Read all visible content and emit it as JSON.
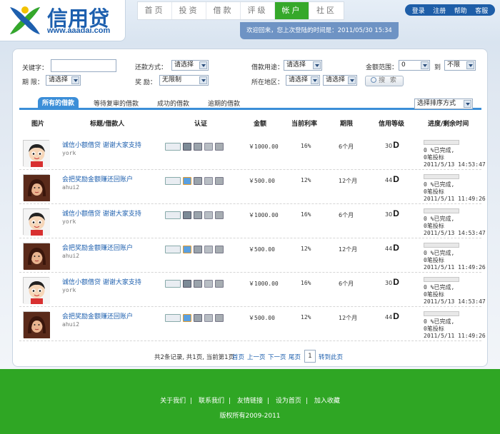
{
  "brand": {
    "name": "信用贷",
    "url": "www.aaadai.com",
    "colors": {
      "blue": "#1d5fae",
      "green": "#35a82a",
      "yellow": "#f2c200"
    }
  },
  "nav": [
    {
      "label": "首页"
    },
    {
      "label": "投资"
    },
    {
      "label": "借款"
    },
    {
      "label": "评级"
    },
    {
      "label": "帐户",
      "active": true
    },
    {
      "label": "社区"
    }
  ],
  "user_bar": {
    "login": "登录",
    "register": "注册",
    "help": "帮助",
    "service": "客服"
  },
  "welcome": "欢迎回来，您上次登陆的时间是：2011/05/30 15:34",
  "filters": {
    "keyword_label": "关键字：",
    "repay_label": "还款方式：",
    "repay_value": "请选择",
    "purpose_label": "借款用途：",
    "purpose_value": "请选择",
    "amount_label": "金额范围：",
    "amount_min": "0",
    "amount_to": "到",
    "amount_max": "不限",
    "term_label": "期 限：",
    "term_value": "请选择",
    "reward_label": "奖 励：",
    "reward_value": "无限制",
    "region_label": "所在地区：",
    "province_value": "请选择",
    "city_value": "请选择",
    "search_label": "搜 索"
  },
  "tabs": [
    {
      "label": "所有的借款",
      "active": true
    },
    {
      "label": "等待复审的借款"
    },
    {
      "label": "成功的借款"
    },
    {
      "label": "逾期的借款"
    }
  ],
  "sort_select": "选择排序方式",
  "columns": {
    "image": "图片",
    "title": "标题/借款人",
    "auth": "认证",
    "amount": "金额",
    "rate": "当前利率",
    "term": "期限",
    "grade": "信用等级",
    "progress": "进度/剩余时间"
  },
  "rows": [
    {
      "title": "诚信小额借贷 谢谢大家支持",
      "user": "york",
      "avatar": "boy",
      "amount": "￥1000.00",
      "rate": "16%",
      "term": "6个月",
      "score": "30",
      "grade": "D",
      "progress_line1": "0 %已完成,",
      "progress_line2": "0笔投标",
      "date": "2011/5/13 14:53:47",
      "progress": 0
    },
    {
      "title": "会把奖励金额赚还回账户",
      "user": "ahui2",
      "avatar": "girl",
      "amount": "￥500.00",
      "rate": "12%",
      "term": "12个月",
      "score": "44",
      "grade": "D",
      "progress_line1": "0 %已完成,",
      "progress_line2": "0笔投标",
      "date": "2011/5/11 11:49:26",
      "progress": 0
    },
    {
      "title": "诚信小额借贷 谢谢大家支持",
      "user": "york",
      "avatar": "boy",
      "amount": "￥1000.00",
      "rate": "16%",
      "term": "6个月",
      "score": "30",
      "grade": "D",
      "progress_line1": "0 %已完成,",
      "progress_line2": "0笔投标",
      "date": "2011/5/13 14:53:47",
      "progress": 0
    },
    {
      "title": "会把奖励金额赚还回账户",
      "user": "ahui2",
      "avatar": "girl",
      "amount": "￥500.00",
      "rate": "12%",
      "term": "12个月",
      "score": "44",
      "grade": "D",
      "progress_line1": "0 %已完成,",
      "progress_line2": "0笔投标",
      "date": "2011/5/11 11:49:26",
      "progress": 0
    },
    {
      "title": "诚信小额借贷 谢谢大家支持",
      "user": "york",
      "avatar": "boy",
      "amount": "￥1000.00",
      "rate": "16%",
      "term": "6个月",
      "score": "30",
      "grade": "D",
      "progress_line1": "0 %已完成,",
      "progress_line2": "0笔投标",
      "date": "2011/5/13 14:53:47",
      "progress": 0
    },
    {
      "title": "会把奖励金额赚还回账户",
      "user": "ahui2",
      "avatar": "girl",
      "amount": "￥500.00",
      "rate": "12%",
      "term": "12个月",
      "score": "44",
      "grade": "D",
      "progress_line1": "0 %已完成,",
      "progress_line2": "0笔投标",
      "date": "2011/5/11 11:49:26",
      "progress": 0
    }
  ],
  "pager": {
    "summary": "共2条记录, 共1页, 当前第1页",
    "first": "首页",
    "prev": "上一页",
    "next": "下一页",
    "last": "尾页",
    "page_input": "1",
    "goto": "转到此页"
  },
  "footer": {
    "links": [
      "关于我们",
      "联系我们",
      "友情链接",
      "设为首页",
      "加入收藏"
    ],
    "separator": "|",
    "copyright": "版权所有2009-2011"
  }
}
